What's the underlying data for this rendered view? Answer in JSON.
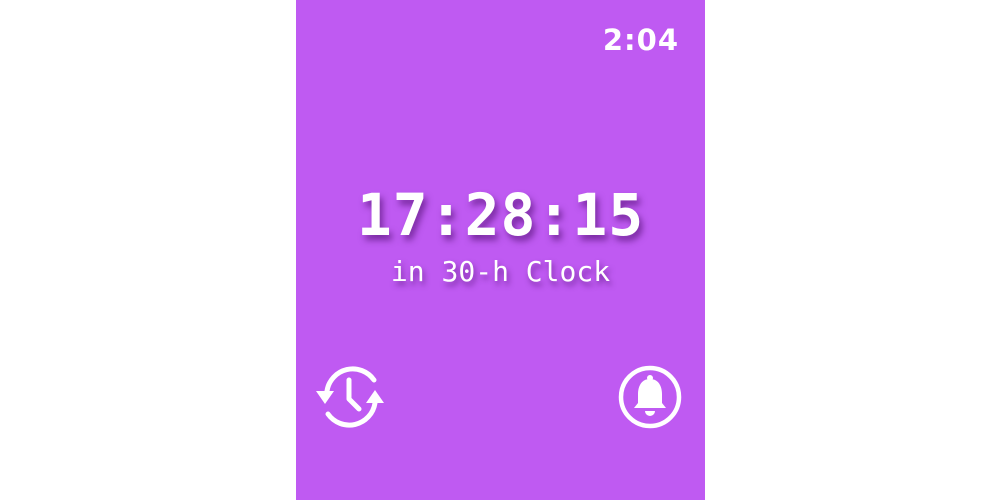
{
  "status_bar": {
    "time": "2:04"
  },
  "clock": {
    "time": "17:28:15",
    "subtitle": "in 30-h Clock"
  },
  "controls": {
    "left_icon": "clock-sync-icon",
    "right_icon": "bell-icon"
  },
  "colors": {
    "background": "#BF5AF2",
    "foreground": "#FFFFFF"
  }
}
